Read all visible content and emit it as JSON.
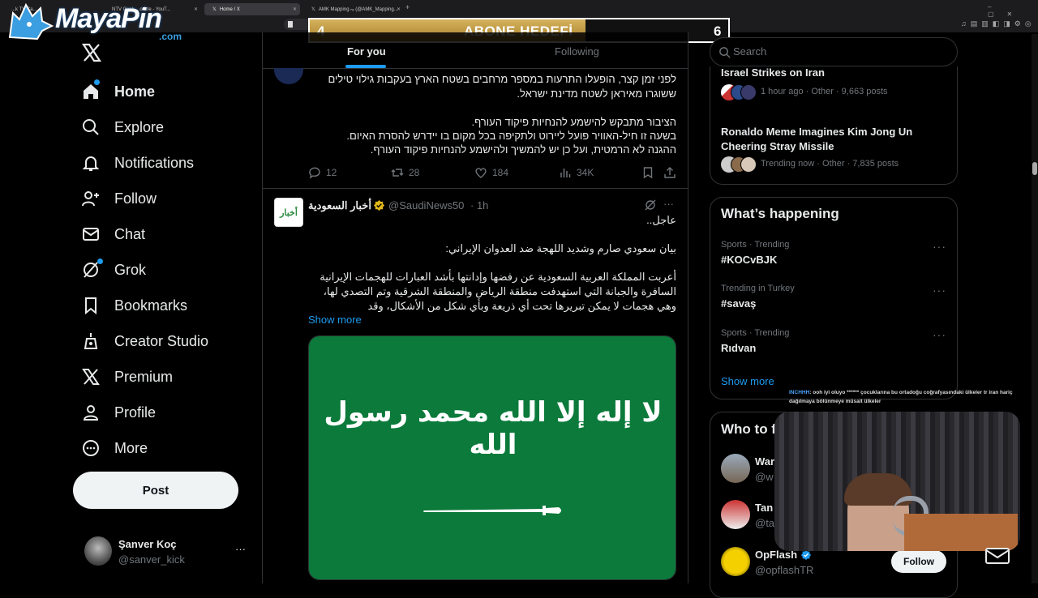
{
  "browser": {
    "tabs": [
      {
        "label": "...k TV Ca...",
        "active": false
      },
      {
        "label": "NTV Canlı ...o İzle - YouT...",
        "active": false
      },
      {
        "label": "Home / X",
        "active": true
      },
      {
        "label": "AMK Mapping ₙₓ (@AMK_Mapping...",
        "active": false
      }
    ],
    "new_tab": "+"
  },
  "overlay": {
    "logo_text": "MayaPin",
    "logo_sub": ".com",
    "goal_left": "4",
    "goal_title": "ABONE HEDEFİ",
    "goal_right": "6",
    "goal_progress": 0.0,
    "chat_user": "INCHHH",
    "chat_message": ": ooh iyi oluyo ****** çocuklarına bu ortadoğu coğrafyasındaki ülkeler tr iran hariç dağılmaya bölünmeye müsait ülkeler"
  },
  "sidebar": {
    "items": [
      {
        "label": "Home",
        "icon": "home-icon"
      },
      {
        "label": "Explore",
        "icon": "search-icon"
      },
      {
        "label": "Notifications",
        "icon": "bell-icon"
      },
      {
        "label": "Follow",
        "icon": "add-person-icon"
      },
      {
        "label": "Chat",
        "icon": "mail-icon"
      },
      {
        "label": "Grok",
        "icon": "grok-icon"
      },
      {
        "label": "Bookmarks",
        "icon": "bookmark-icon"
      },
      {
        "label": "Creator Studio",
        "icon": "creator-studio-icon"
      },
      {
        "label": "Premium",
        "icon": "x-logo-icon"
      },
      {
        "label": "Profile",
        "icon": "profile-icon"
      },
      {
        "label": "More",
        "icon": "more-circle-icon"
      }
    ],
    "post_label": "Post",
    "account_name": "Şanver Koç",
    "account_handle": "@sanver_kick",
    "account_more": "···"
  },
  "timeline": {
    "tabs": [
      {
        "label": "For you",
        "active": true
      },
      {
        "label": "Following",
        "active": false
      }
    ],
    "tweet1": {
      "lines": [
        "לפני זמן קצר, הופעלו התרעות במספר מרחבים בשטח הארץ בעקבות גילוי טילים",
        "ששוגרו מאיראן לשטח מדינת ישראל.",
        "",
        "הציבור מתבקש להישמע להנחיות פיקוד העורף.",
        "בשעה זו חיל-האוויר פועל ליירוט ולתקיפה בכל מקום בו יידרש להסרת האיום.",
        "ההגנה לא הרמטית, ועל כן יש להמשיך ולהישמע להנחיות פיקוד העורף."
      ],
      "replies": "12",
      "reposts": "28",
      "likes": "184",
      "views": "34K"
    },
    "tweet2": {
      "avatar_text": "أخبار",
      "name": "أخبار السعودية",
      "handle": "@SaudiNews50",
      "time": "· 1h",
      "lines": [
        "عاجل..",
        "",
        "بيان سعودي صارم وشديد اللهجة ضد العدوان الإيراني:",
        "",
        "أعربت المملكة العربية السعودية عن رفضها وإدانتها بأشد العبارات للهجمات الإيرانية",
        "السافرة والجبانة التي استهدفت منطقة الرياض والمنطقة الشرقية وتم التصدي لها،",
        "وهي هجمات لا يمكن تبريرها تحت أي ذريعة وبأي شكل من الأشكال، وقد"
      ],
      "show_more": "Show more",
      "flag_text": "لا إله إلا الله محمد رسول الله",
      "flag_color": "#0b7a3b"
    }
  },
  "right": {
    "search_placeholder": "Search",
    "trends_top": [
      {
        "title": "Israel Strikes on Iran",
        "meta": "1 hour ago · Other · 9,663 posts"
      },
      {
        "title": "Ronaldo Meme Imagines Kim Jong Un Cheering Stray Missile",
        "meta": "Trending now · Other · 7,835 posts"
      }
    ],
    "happening_title": "What’s happening",
    "happening": [
      {
        "meta": "Sports · Trending",
        "name": "#KOCvBJK"
      },
      {
        "meta": "Trending in Turkey",
        "name": "#savaş"
      },
      {
        "meta": "Sports · Trending",
        "name": "Rıdvan"
      }
    ],
    "show_more": "Show more",
    "who_title": "Who to follow",
    "who": [
      {
        "name": "War",
        "handle": "@w"
      },
      {
        "name": "Tan",
        "handle": "@ta"
      },
      {
        "name": "OpFlash",
        "handle": "@opflashTR",
        "follow": "Follow"
      }
    ]
  },
  "colors": {
    "accent": "#1d9bf0",
    "bg": "#000000",
    "border": "#2f3336",
    "muted": "#71767b",
    "gold": "#c8a24a"
  }
}
